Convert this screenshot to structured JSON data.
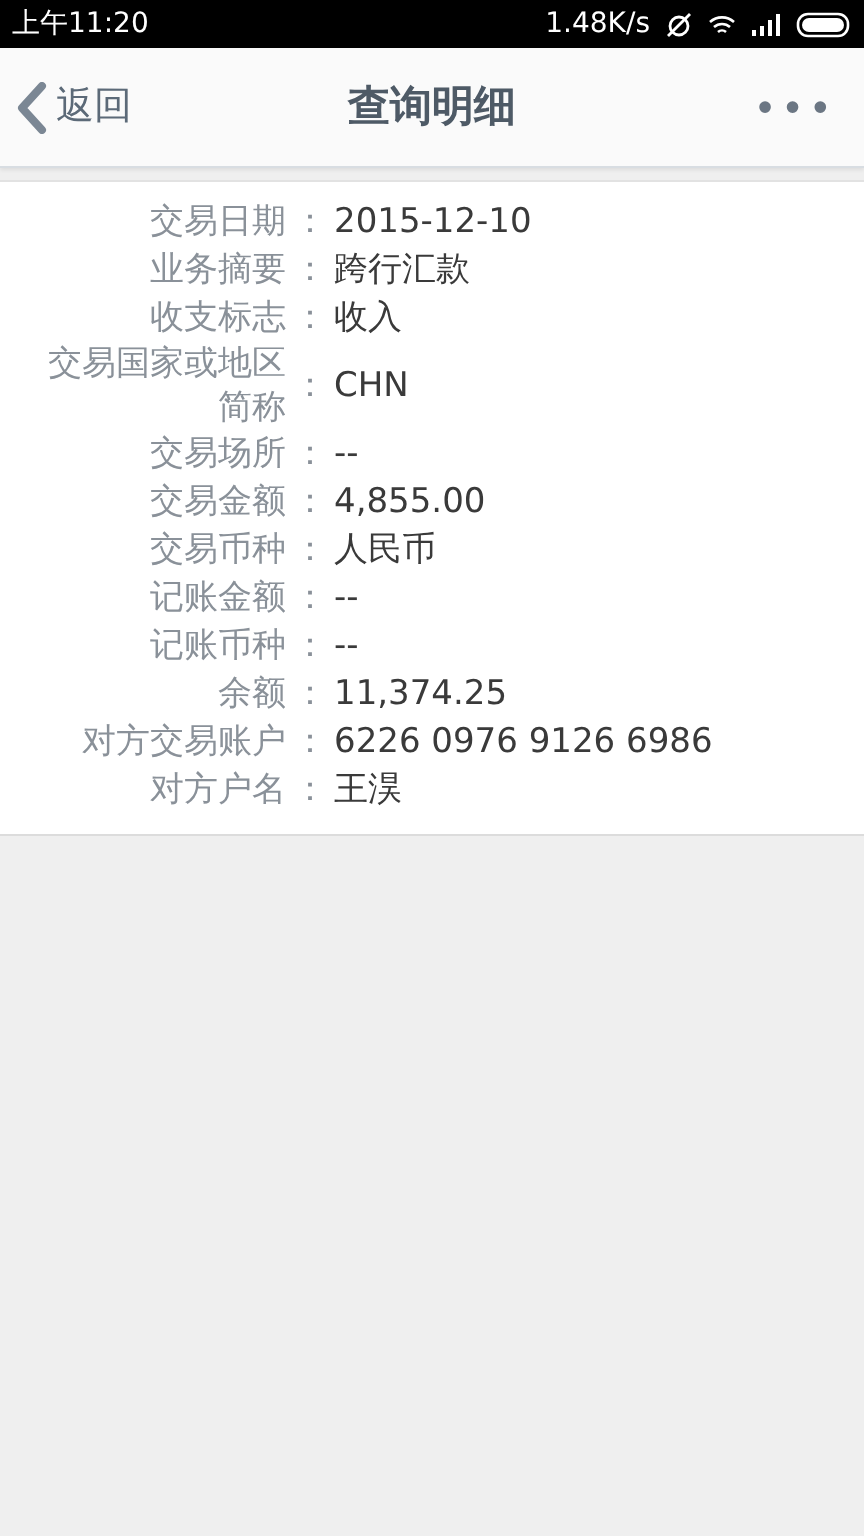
{
  "status_bar": {
    "time": "上午11:20",
    "speed": "1.48K/s"
  },
  "header": {
    "back": "返回",
    "title": "查询明细",
    "more": "•••"
  },
  "details": [
    {
      "label": "交易日期",
      "separator": "：",
      "value": "2015-12-10"
    },
    {
      "label": "业务摘要",
      "separator": "：",
      "value": "跨行汇款"
    },
    {
      "label": "收支标志",
      "separator": "：",
      "value": "收入"
    },
    {
      "label": "交易国家或地区简称",
      "separator": "：",
      "value": "CHN"
    },
    {
      "label": "交易场所",
      "separator": "：",
      "value": "--"
    },
    {
      "label": "交易金额",
      "separator": "：",
      "value": "4,855.00"
    },
    {
      "label": "交易币种",
      "separator": "：",
      "value": "人民币"
    },
    {
      "label": "记账金额",
      "separator": "：",
      "value": "--"
    },
    {
      "label": "记账币种",
      "separator": "：",
      "value": "--"
    },
    {
      "label": "余额",
      "separator": "：",
      "value": "11,374.25"
    },
    {
      "label": "对方交易账户",
      "separator": "：",
      "value": "6226 0976 9126 6986"
    },
    {
      "label": "对方户名",
      "separator": "：",
      "value": "王淏"
    }
  ]
}
